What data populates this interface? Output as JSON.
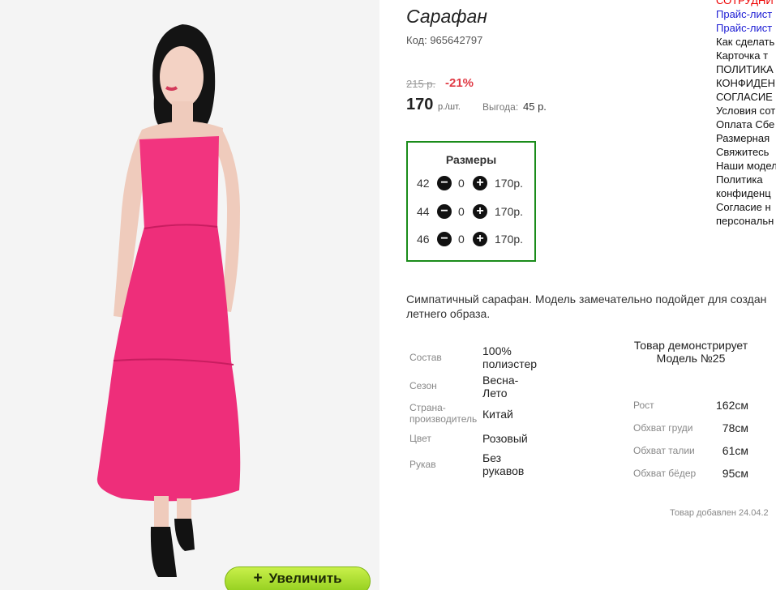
{
  "product": {
    "title": "Сарафан",
    "code": "Код: 965642797",
    "old_price": "215 р.",
    "discount": "-21%",
    "price": "170",
    "price_unit": "р./шт.",
    "benefit_label": "Выгода:",
    "benefit_value": "45 р.",
    "zoom_button": "Увеличить",
    "zoom_icon": "plus-icon",
    "description_line1": "Симпатичный сарафан. Модель замечательно подойдет для создан",
    "description_line2": "летнего образа.",
    "added": "Товар добавлен 24.04.2"
  },
  "sizes": {
    "title": "Размеры",
    "rows": [
      {
        "size": "42",
        "qty": "0",
        "price": "170р."
      },
      {
        "size": "44",
        "qty": "0",
        "price": "170р."
      },
      {
        "size": "46",
        "qty": "0",
        "price": "170р."
      }
    ],
    "frame_color": "#1a8c1a"
  },
  "attributes": [
    {
      "label": "Состав",
      "value": "100% полиэстер"
    },
    {
      "label": "Сезон",
      "value": "Весна-Лето"
    },
    {
      "label": "Страна-производитель",
      "value": "Китай"
    },
    {
      "label": "Цвет",
      "value": "Розовый"
    },
    {
      "label": "Рукав",
      "value": "Без рукавов"
    }
  ],
  "model": {
    "heading": "Товар демонстрирует Модель №25",
    "params": [
      {
        "label": "Рост",
        "value": "162см"
      },
      {
        "label": "Обхват груди",
        "value": "78см"
      },
      {
        "label": "Обхват талии",
        "value": "61см"
      },
      {
        "label": "Обхват бёдер",
        "value": "95см"
      }
    ]
  },
  "sidebar_links": [
    "СОТРУДНИ",
    "Прайс-лист",
    "Прайс-лист",
    "Как сделать",
    "Карточка т",
    "ПОЛИТИКА",
    "КОНФИДЕН",
    "СОГЛАСИЕ",
    "Условия сот",
    "Оплата Сбе",
    "Размерная",
    "Свяжитесь",
    "Наши модел",
    "Политика",
    "конфиденц",
    "Согласие н",
    "персональн"
  ],
  "colors": {
    "dress": "#f0337f",
    "discount": "#e03a45",
    "zoom_button": "#a8de2a",
    "link_blue": "#1c1cd4",
    "link_red": "#e00000"
  }
}
